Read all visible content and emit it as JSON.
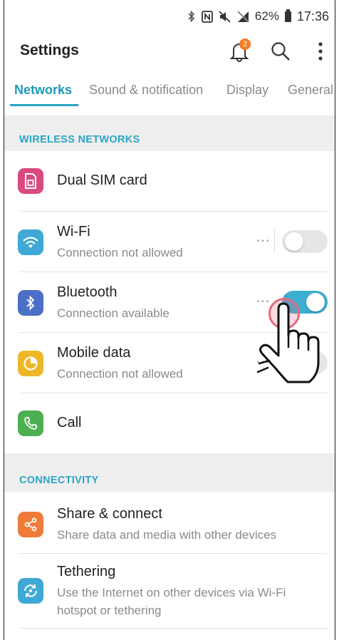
{
  "status_bar": {
    "battery": "62%",
    "time": "17:36"
  },
  "header": {
    "title": "Settings",
    "notification_count": "2"
  },
  "tabs": [
    {
      "label": "Networks",
      "active": true
    },
    {
      "label": "Sound & notification",
      "active": false
    },
    {
      "label": "Display",
      "active": false
    },
    {
      "label": "General",
      "active": false
    }
  ],
  "sections": {
    "wireless": "WIRELESS NETWORKS",
    "connectivity": "CONNECTIVITY"
  },
  "items": {
    "dual_sim": {
      "title": "Dual SIM card",
      "icon": "sim-card-icon",
      "color": "#d94a7e"
    },
    "wifi": {
      "title": "Wi-Fi",
      "subtitle": "Connection not allowed",
      "icon": "wifi-icon",
      "color": "#3fa8d4",
      "enabled": false
    },
    "bluetooth": {
      "title": "Bluetooth",
      "subtitle": "Connection available",
      "icon": "bluetooth-icon",
      "color": "#4b6fc7",
      "enabled": true
    },
    "mobile_data": {
      "title": "Mobile data",
      "subtitle": "Connection not allowed",
      "icon": "mobile-data-icon",
      "color": "#ecb829",
      "enabled": false
    },
    "call": {
      "title": "Call",
      "icon": "phone-icon",
      "color": "#4caf50"
    },
    "share": {
      "title": "Share & connect",
      "subtitle": "Share data and media with other devices",
      "icon": "share-icon",
      "color": "#ef7b3a"
    },
    "tethering": {
      "title": "Tethering",
      "subtitle_line1": "Use the Internet on other devices via Wi-Fi",
      "subtitle_line2": "hotspot or tethering",
      "icon": "tethering-icon",
      "color": "#3fa8d4"
    }
  },
  "more_label": "⋯"
}
